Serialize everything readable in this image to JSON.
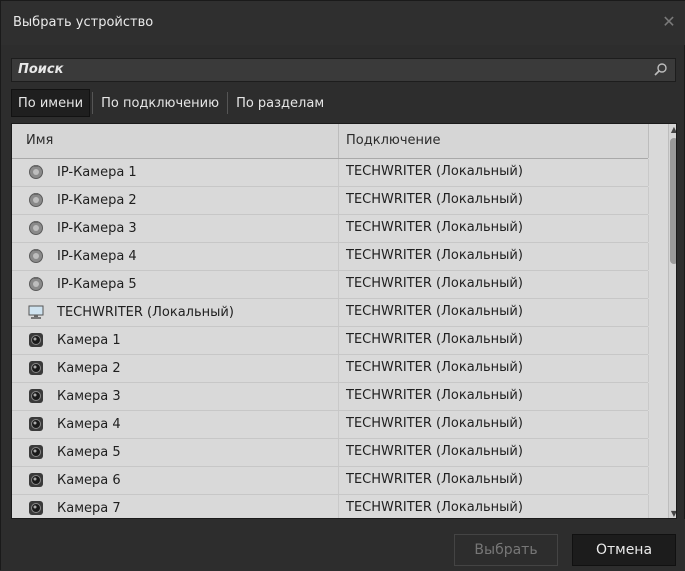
{
  "window": {
    "title": "Выбрать устройство"
  },
  "search": {
    "placeholder": "Поиск"
  },
  "tabs": [
    {
      "label": "По имени",
      "active": true
    },
    {
      "label": "По подключению",
      "active": false
    },
    {
      "label": "По разделам",
      "active": false
    }
  ],
  "table": {
    "headers": {
      "name": "Имя",
      "connection": "Подключение"
    },
    "rows": [
      {
        "icon": "ip-camera-icon",
        "name": "IP-Камера 1",
        "connection": "TECHWRITER (Локальный)"
      },
      {
        "icon": "ip-camera-icon",
        "name": "IP-Камера 2",
        "connection": "TECHWRITER (Локальный)"
      },
      {
        "icon": "ip-camera-icon",
        "name": "IP-Камера 3",
        "connection": "TECHWRITER (Локальный)"
      },
      {
        "icon": "ip-camera-icon",
        "name": "IP-Камера 4",
        "connection": "TECHWRITER (Локальный)"
      },
      {
        "icon": "ip-camera-icon",
        "name": "IP-Камера 5",
        "connection": "TECHWRITER (Локальный)"
      },
      {
        "icon": "computer-icon",
        "name": "TECHWRITER (Локальный)",
        "connection": "TECHWRITER (Локальный)"
      },
      {
        "icon": "camera-icon",
        "name": "Камера 1",
        "connection": "TECHWRITER (Локальный)"
      },
      {
        "icon": "camera-icon",
        "name": "Камера 2",
        "connection": "TECHWRITER (Локальный)"
      },
      {
        "icon": "camera-icon",
        "name": "Камера 3",
        "connection": "TECHWRITER (Локальный)"
      },
      {
        "icon": "camera-icon",
        "name": "Камера 4",
        "connection": "TECHWRITER (Локальный)"
      },
      {
        "icon": "camera-icon",
        "name": "Камера 5",
        "connection": "TECHWRITER (Локальный)"
      },
      {
        "icon": "camera-icon",
        "name": "Камера 6",
        "connection": "TECHWRITER (Локальный)"
      },
      {
        "icon": "camera-icon",
        "name": "Камера 7",
        "connection": "TECHWRITER (Локальный)"
      }
    ]
  },
  "buttons": {
    "select": "Выбрать",
    "cancel": "Отмена"
  },
  "colors": {
    "background": "#2d2d2d",
    "table": "#d9d9d9",
    "text": "#eaeaea"
  }
}
